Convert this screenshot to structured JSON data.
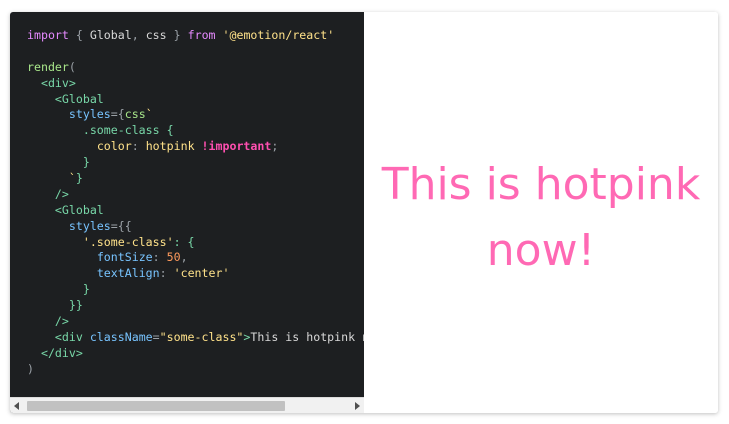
{
  "code": {
    "line1": {
      "kw1": "import",
      "p1": " { ",
      "t1": "Global",
      "p2": ", ",
      "t2": "css",
      "p3": " } ",
      "kw2": "from",
      "p4": " ",
      "s1": "'@emotion/react'"
    },
    "line3": {
      "fn": "render",
      "p": "("
    },
    "line4": {
      "indent": "  ",
      "t": "<div>"
    },
    "line5": {
      "indent": "    ",
      "t": "<Global"
    },
    "line6": {
      "indent": "      ",
      "a": "styles",
      "p": "={",
      "kw": "css",
      "s": "`"
    },
    "line7": {
      "indent": "        ",
      "t": ".some-class {"
    },
    "line8": {
      "indent": "          ",
      "a": "color",
      "p": ": ",
      "v": "hotpink",
      "sp": " ",
      "imp": "!important",
      "e": ";"
    },
    "line9": {
      "indent": "        ",
      "t": "}"
    },
    "line10": {
      "indent": "      ",
      "s": "`",
      "p": "}"
    },
    "line11": {
      "indent": "    ",
      "t": "/>"
    },
    "line12": {
      "indent": "    ",
      "t": "<Global"
    },
    "line13": {
      "indent": "      ",
      "a": "styles",
      "p": "={{"
    },
    "line14": {
      "indent": "        ",
      "s": "'.some-class'",
      "p": ": {"
    },
    "line15": {
      "indent": "          ",
      "a": "fontSize",
      "p": ": ",
      "n": "50",
      "e": ","
    },
    "line16": {
      "indent": "          ",
      "a": "textAlign",
      "p": ": ",
      "s": "'center'"
    },
    "line17": {
      "indent": "        ",
      "t": "}"
    },
    "line18": {
      "indent": "      ",
      "t": "}}"
    },
    "line19": {
      "indent": "    ",
      "t": "/>"
    },
    "line20": {
      "indent": "    ",
      "t1": "<div ",
      "a": "className",
      "p": "=",
      "s": "\"some-class\"",
      "t2": ">",
      "txt": "This is hotpink n"
    },
    "line21": {
      "indent": "  ",
      "t": "</div>"
    },
    "line22": {
      "p": ")"
    }
  },
  "preview": {
    "text": "This is hotpink now!",
    "color": "#ff69b4"
  },
  "colors": {
    "editor_bg": "#1d1f21",
    "preview_bg": "#ffffff"
  }
}
